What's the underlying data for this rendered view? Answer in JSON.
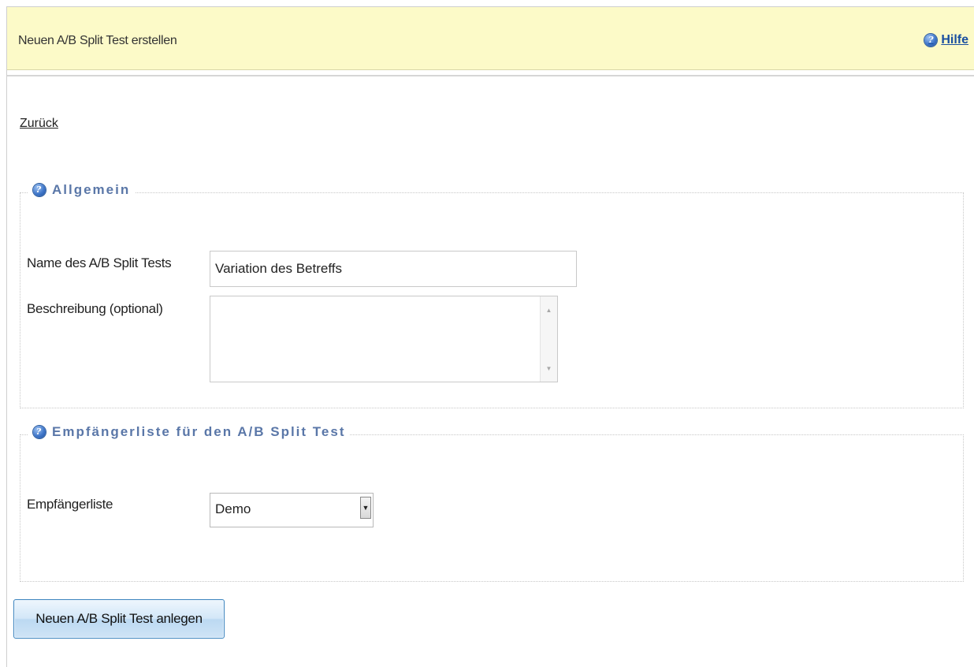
{
  "header": {
    "title": "Neuen A/B Split Test erstellen",
    "help_label": "Hilfe",
    "help_icon": "help-question-icon"
  },
  "nav": {
    "back_label": "Zurück"
  },
  "general_section": {
    "legend": "Allgemein",
    "legend_icon": "help-question-icon",
    "name_label": "Name des A/B Split Tests",
    "name_value": "Variation des Betreffs",
    "description_label": "Beschreibung (optional)",
    "description_value": ""
  },
  "recipients_section": {
    "legend": "Empfängerliste für den A/B Split Test",
    "legend_icon": "help-question-icon",
    "list_label": "Empfängerliste",
    "list_selected": "Demo"
  },
  "actions": {
    "submit_label": "Neuen A/B Split Test anlegen"
  },
  "colors": {
    "header_bg": "#fcfac8",
    "legend_text": "#5a77a8",
    "link": "#1a4fa0",
    "button_border": "#3f86bf"
  }
}
